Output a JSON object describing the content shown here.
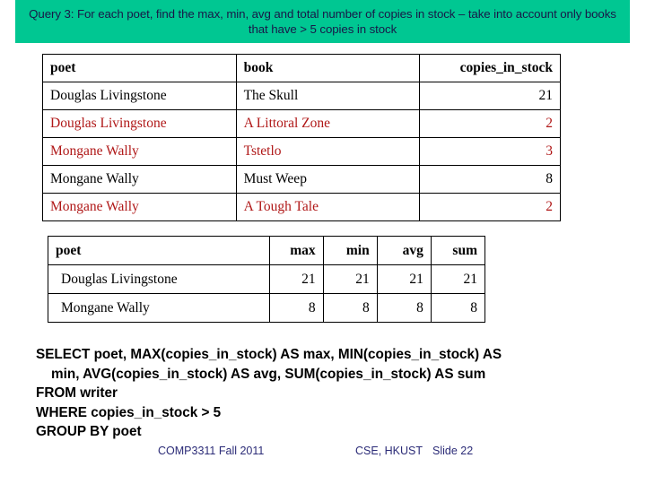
{
  "slide": {
    "title": "Query 3: For each poet, find the max, min, avg and total number of copies in stock – take into account only books that have > 5 copies in stock",
    "banner_color": "#00C792",
    "banner_text_color": "#181848",
    "highlight_color": "#B01818"
  },
  "stock_table": {
    "headers": {
      "poet": "poet",
      "book": "book",
      "copies": "copies_in_stock"
    },
    "rows": [
      {
        "poet": "Douglas Livingstone",
        "book": "The Skull",
        "copies": "21",
        "highlight": false
      },
      {
        "poet": "Douglas Livingstone",
        "book": "A Littoral Zone",
        "copies": "2",
        "highlight": true
      },
      {
        "poet": "Mongane Wally",
        "book": "Tstetlo",
        "copies": "3",
        "highlight": true
      },
      {
        "poet": "Mongane Wally",
        "book": "Must Weep",
        "copies": "8",
        "highlight": false
      },
      {
        "poet": "Mongane Wally",
        "book": "A Tough Tale",
        "copies": "2",
        "highlight": true
      }
    ]
  },
  "result_table": {
    "headers": {
      "poet": "poet",
      "max": "max",
      "min": "min",
      "avg": "avg",
      "sum": "sum"
    },
    "rows": [
      {
        "poet": "Douglas Livingstone",
        "max": "21",
        "min": "21",
        "avg": "21",
        "sum": "21"
      },
      {
        "poet": "Mongane Wally",
        "max": "8",
        "min": "8",
        "avg": "8",
        "sum": "8"
      }
    ]
  },
  "sql": {
    "line1": "SELECT poet, MAX(copies_in_stock) AS max, MIN(copies_in_stock) AS",
    "line2": "    min, AVG(copies_in_stock) AS avg, SUM(copies_in_stock) AS sum",
    "line3": "FROM writer",
    "line4": "WHERE copies_in_stock > 5",
    "line5": "GROUP BY poet"
  },
  "footer": {
    "left": "COMP3311 Fall 2011",
    "course": "CSE, HKUST",
    "slide_number": "Slide 22",
    "text_color": "#2B2B77"
  }
}
